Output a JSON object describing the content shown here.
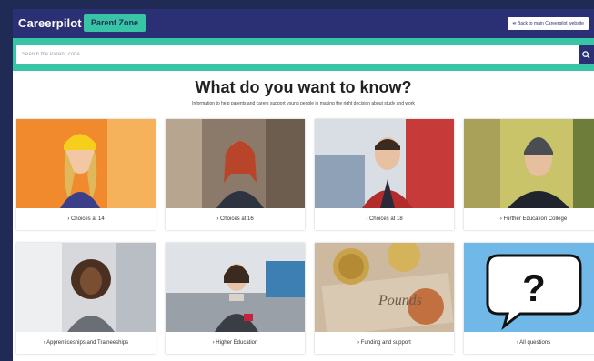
{
  "header": {
    "logo_text": "Careerpilot",
    "zone_badge": "Parent Zone",
    "back_link": "⇚ Back to main Careerpilot website"
  },
  "search": {
    "placeholder": "Search the Parent Zone",
    "button_icon": "search-icon"
  },
  "main": {
    "title": "What do you want to know?",
    "subtitle": "Information to help parents and carers support young people in making the right decision about study and work"
  },
  "cards": [
    {
      "label": "› Choices at 14"
    },
    {
      "label": "› Choices at 16"
    },
    {
      "label": "› Choices at 18"
    },
    {
      "label": "› Further Education College"
    },
    {
      "label": "› Apprenticeships and Traineeships"
    },
    {
      "label": "› Higher Education"
    },
    {
      "label": "› Funding and support"
    },
    {
      "label": "› All questions"
    }
  ],
  "colors": {
    "navy": "#2b2f73",
    "teal": "#37c5a5",
    "outer_bg": "#1f2a55"
  }
}
